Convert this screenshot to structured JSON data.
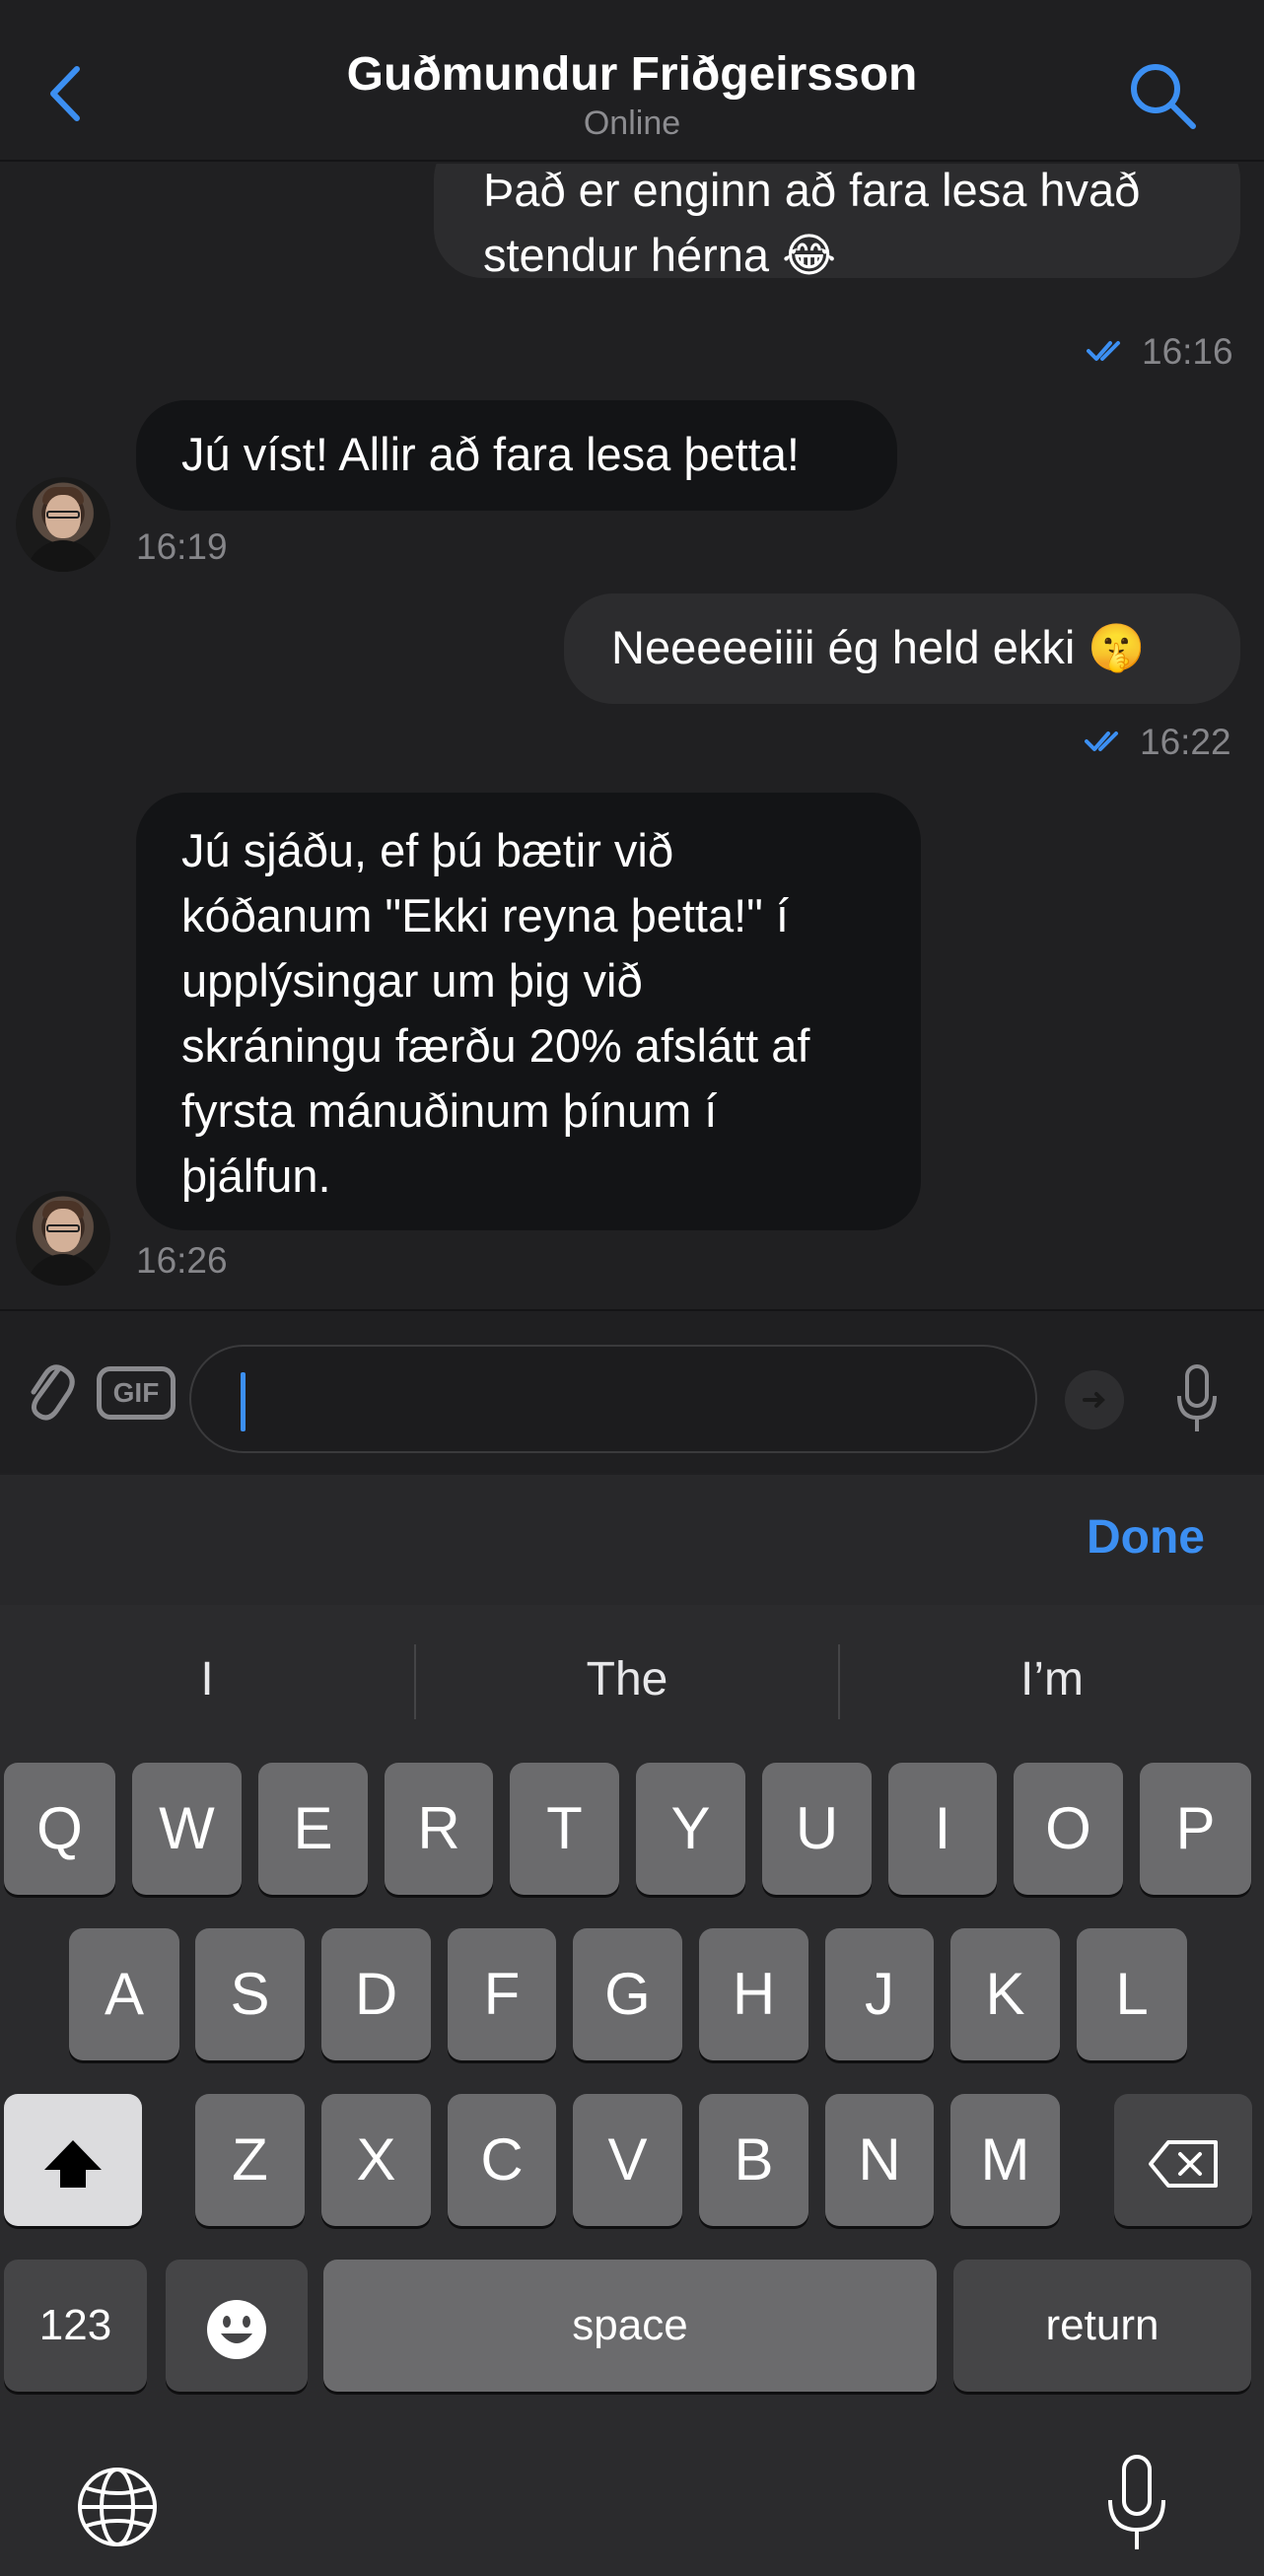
{
  "header": {
    "title": "Guðmundur Friðgeirsson",
    "status": "Online"
  },
  "messages": [
    {
      "direction": "out",
      "lines": [
        "Það er enginn að fara lesa hvað",
        "stendur hérna 😂"
      ],
      "time": "16:16",
      "read": true
    },
    {
      "direction": "in",
      "lines": [
        "Jú víst! Allir að fara lesa þetta!"
      ],
      "time": "16:19"
    },
    {
      "direction": "out",
      "lines": [
        "Neeeeeiiii ég held ekki 🤫"
      ],
      "time": "16:22",
      "read": true
    },
    {
      "direction": "in",
      "lines": [
        "Jú sjáðu, ef þú bætir við",
        "kóðanum \"Ekki reyna þetta!\" í",
        "upplýsingar um þig við",
        "skráningu færðu 20% afslátt af",
        "fyrsta mánuðinum þínum í",
        "þjálfun."
      ],
      "time": "16:26"
    }
  ],
  "composer": {
    "gif_label": "GIF",
    "value": ""
  },
  "done_label": "Done",
  "keyboard": {
    "suggestions": [
      "I",
      "The",
      "I’m"
    ],
    "row1": [
      "Q",
      "W",
      "E",
      "R",
      "T",
      "Y",
      "U",
      "I",
      "O",
      "P"
    ],
    "row2": [
      "A",
      "S",
      "D",
      "F",
      "G",
      "H",
      "J",
      "K",
      "L"
    ],
    "row3": [
      "Z",
      "X",
      "C",
      "V",
      "B",
      "N",
      "M"
    ],
    "numbers_label": "123",
    "space_label": "space",
    "return_label": "return"
  },
  "colors": {
    "accent": "#3c8ff2",
    "background": "#202022",
    "incoming_bubble": "#131416",
    "outgoing_bubble": "#2c2c2e"
  }
}
